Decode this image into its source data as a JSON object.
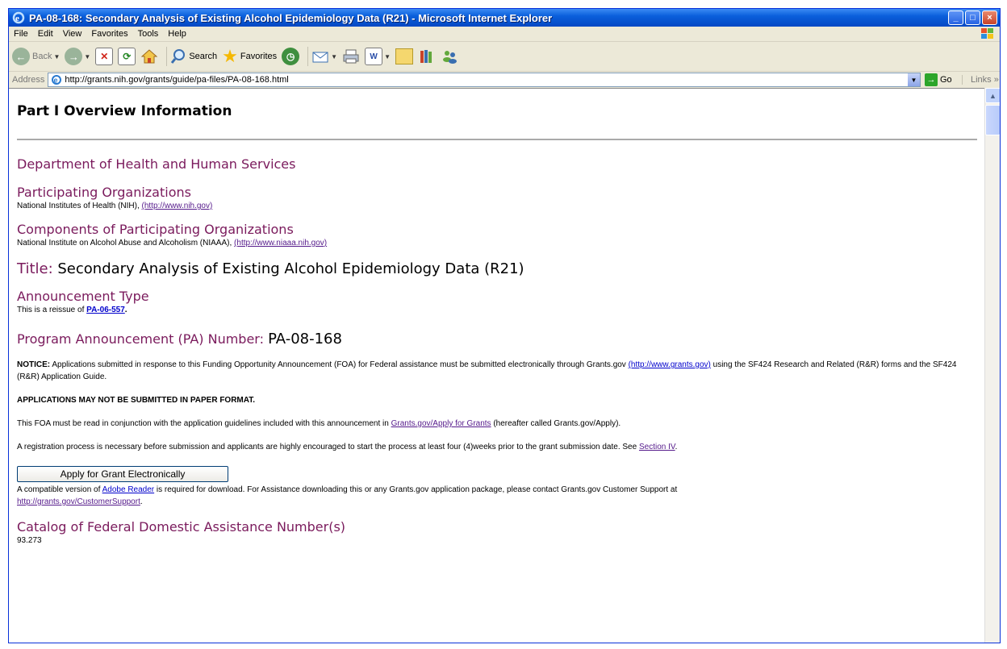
{
  "window": {
    "title": "PA-08-168: Secondary Analysis of Existing Alcohol Epidemiology Data (R21) - Microsoft Internet Explorer",
    "buttons": [
      "minimize",
      "maximize",
      "close"
    ]
  },
  "menu": [
    "File",
    "Edit",
    "View",
    "Favorites",
    "Tools",
    "Help"
  ],
  "toolbar": {
    "back_label": "Back",
    "search_label": "Search",
    "favorites_label": "Favorites"
  },
  "address": {
    "label": "Address",
    "url": "http://grants.nih.gov/grants/guide/pa-files/PA-08-168.html",
    "go_label": "Go",
    "links_label": "Links"
  },
  "page": {
    "part_heading": "Part I Overview Information",
    "department": "Department of Health and Human Services",
    "participating_heading": "Participating Organizations",
    "participating_text": "National Institutes of Health (NIH), ",
    "participating_link": "(http://www.nih.gov)",
    "components_heading": "Components of Participating Organizations",
    "components_text": "National Institute on Alcohol Abuse and Alcoholism (NIAAA), ",
    "components_link": "(http://www.niaaa.nih.gov)",
    "title_label": "Title: ",
    "title_value": "Secondary Analysis of Existing Alcohol Epidemiology Data (R21)",
    "announcement_heading": "Announcement Type",
    "announcement_text": "This is a reissue of ",
    "announcement_link": "PA-06-557",
    "pa_label": "Program Announcement (PA) Number: ",
    "pa_value": "PA-08-168",
    "notice_bold": "NOTICE:",
    "notice_text": " Applications submitted in response to this Funding Opportunity Announcement (FOA) for Federal assistance must be submitted electronically through Grants.gov ",
    "notice_link": "(http://www.grants.gov)",
    "notice_text2": " using the SF424 Research and Related (R&R) forms and the SF424 (R&R) Application Guide.",
    "no_paper": "APPLICATIONS MAY NOT BE SUBMITTED IN PAPER FORMAT.",
    "foa_text": "This FOA must be read in conjunction with the application guidelines included with this announcement in ",
    "foa_link": "Grants.gov/Apply for Grants",
    "foa_text2": " (hereafter called Grants.gov/Apply).",
    "reg_text": "A registration process is necessary before submission and applicants are highly encouraged to start the process at least four (4)weeks prior to the grant submission date. See ",
    "reg_link": "Section IV",
    "reg_end": ".",
    "apply_button": "Apply for Grant Electronically",
    "compat_text": "A compatible version of ",
    "compat_link": "Adobe Reader",
    "compat_text2": " is required for download. For Assistance downloading this or any Grants.gov application package, please contact Grants.gov Customer Support at ",
    "support_link": "http://grants.gov/CustomerSupport",
    "support_end": ".",
    "catalog_heading": "Catalog of Federal Domestic Assistance Number(s)",
    "catalog_value": "93.273"
  }
}
